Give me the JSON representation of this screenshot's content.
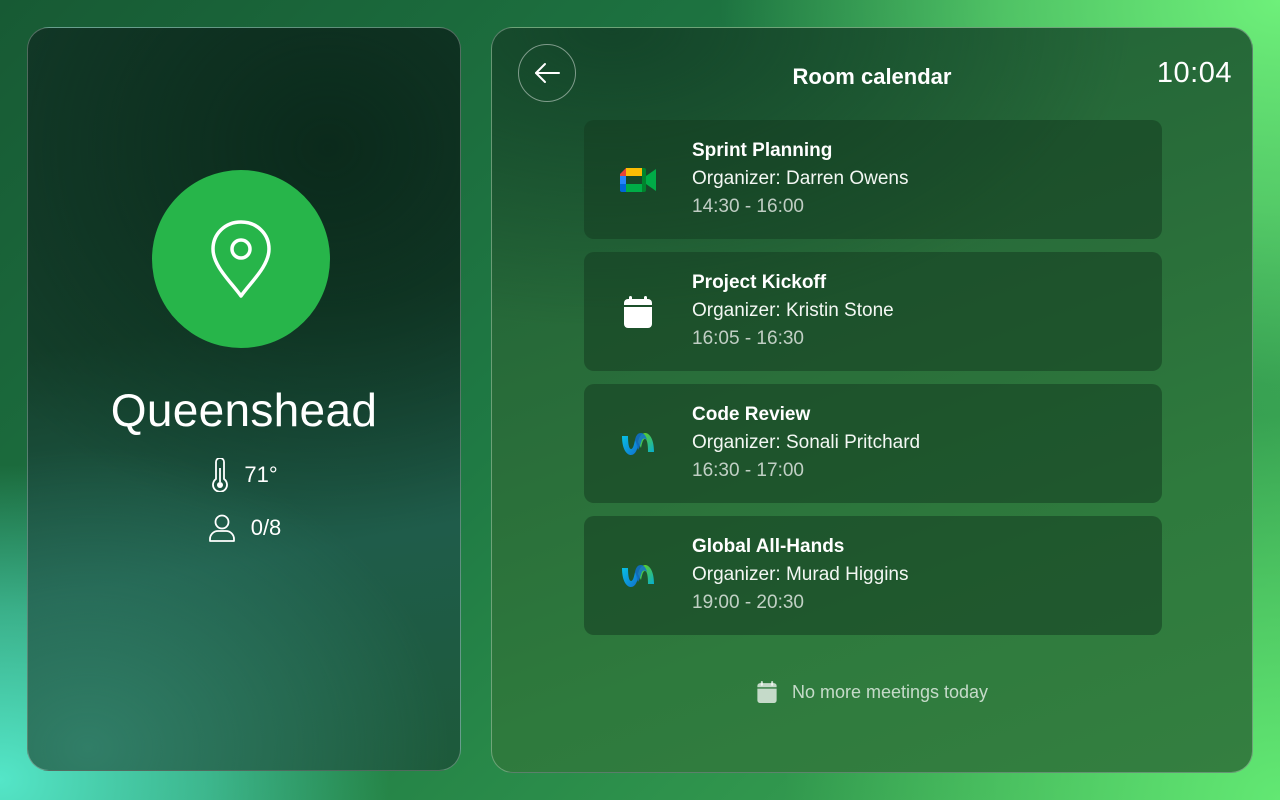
{
  "room": {
    "name": "Queenshead",
    "temperature": "71°",
    "occupancy": "0/8",
    "icon": "location-pin-icon",
    "accent_color": "#27b54a"
  },
  "header": {
    "title": "Room calendar",
    "time": "10:04",
    "back_icon": "arrow-left-icon"
  },
  "meetings": [
    {
      "title": "Sprint Planning",
      "organizer": "Organizer: Darren Owens",
      "time": "14:30 - 16:00",
      "icon": "google-meet-icon"
    },
    {
      "title": "Project Kickoff",
      "organizer": "Organizer: Kristin Stone",
      "time": "16:05 - 16:30",
      "icon": "calendar-icon"
    },
    {
      "title": "Code Review",
      "organizer": "Organizer: Sonali Pritchard",
      "time": "16:30 - 17:00",
      "icon": "webex-icon"
    },
    {
      "title": "Global All-Hands",
      "organizer": "Organizer: Murad Higgins",
      "time": "19:00 - 20:30",
      "icon": "webex-icon"
    }
  ],
  "footer": {
    "message": "No more meetings today",
    "icon": "calendar-icon"
  }
}
